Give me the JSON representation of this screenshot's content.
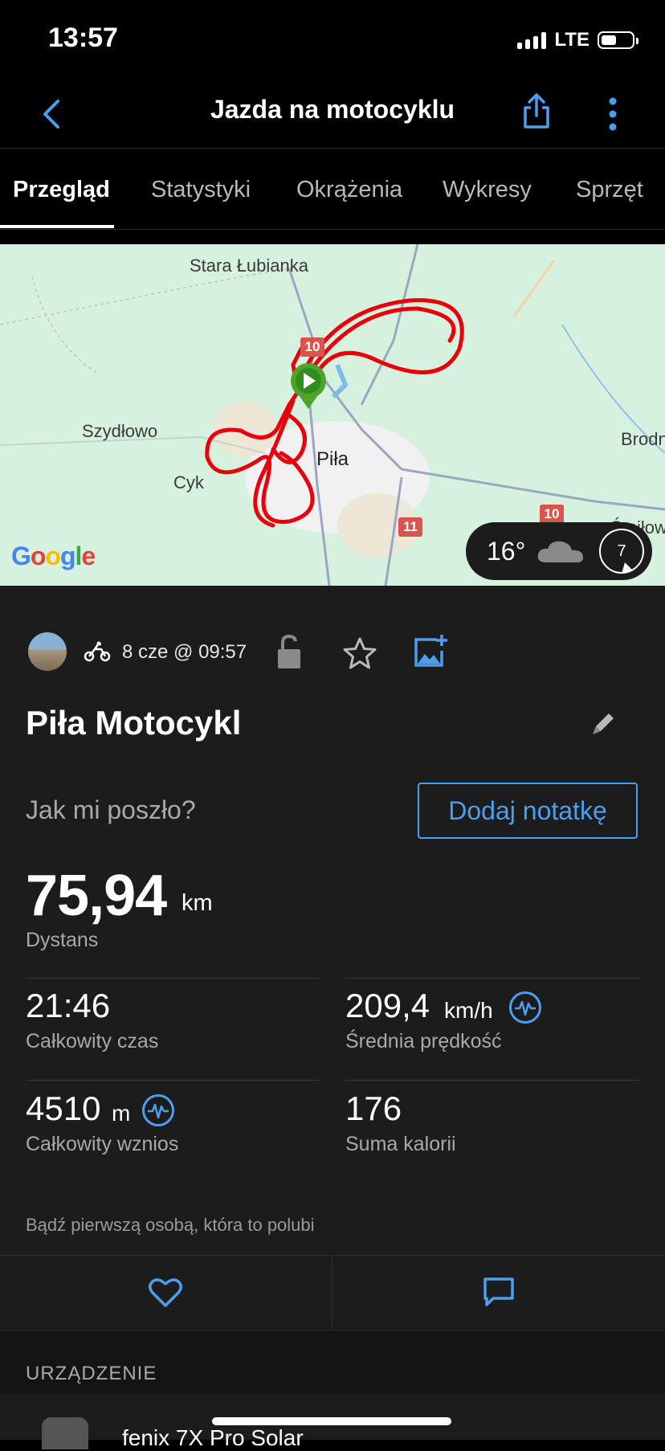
{
  "status_bar": {
    "time": "13:57",
    "network": "LTE"
  },
  "header": {
    "title": "Jazda na motocyklu"
  },
  "tabs": [
    {
      "label": "Przegląd",
      "active": true
    },
    {
      "label": "Statystyki"
    },
    {
      "label": "Okrążenia"
    },
    {
      "label": "Wykresy"
    },
    {
      "label": "Sprzęt"
    }
  ],
  "map": {
    "places": [
      "Stara Łubianka",
      "Szydłowo",
      "Cyk",
      "Piła",
      "Brodn",
      "Śmiłow"
    ],
    "road_numbers": [
      "10",
      "11",
      "10"
    ],
    "provider": "Google",
    "weather": {
      "temperature": "16°",
      "wind": "7",
      "icon": "cloud-icon"
    }
  },
  "activity": {
    "date": "8 cze @ 09:57",
    "name": "Piła Motocykl",
    "feel_question": "Jak mi poszło?",
    "add_note": "Dodaj notatkę"
  },
  "stats": {
    "distance": {
      "value": "75,94",
      "unit": "km",
      "label": "Dystans"
    },
    "time": {
      "value": "21:46",
      "label": "Całkowity czas"
    },
    "speed": {
      "value": "209,4",
      "unit": "km/h",
      "label": "Średnia prędkość"
    },
    "ascent": {
      "value": "4510",
      "unit": "m",
      "label": "Całkowity wznios"
    },
    "calories": {
      "value": "176",
      "label": "Suma kalorii"
    }
  },
  "social": {
    "likes_text": "Bądź pierwszą osobą, która to polubi"
  },
  "device": {
    "section_label": "URZĄDZENIE",
    "name": "fenix 7X Pro Solar"
  },
  "colors": {
    "accent": "#4a9ff0",
    "route": "#e8000b",
    "background": "#1c1c1c"
  }
}
